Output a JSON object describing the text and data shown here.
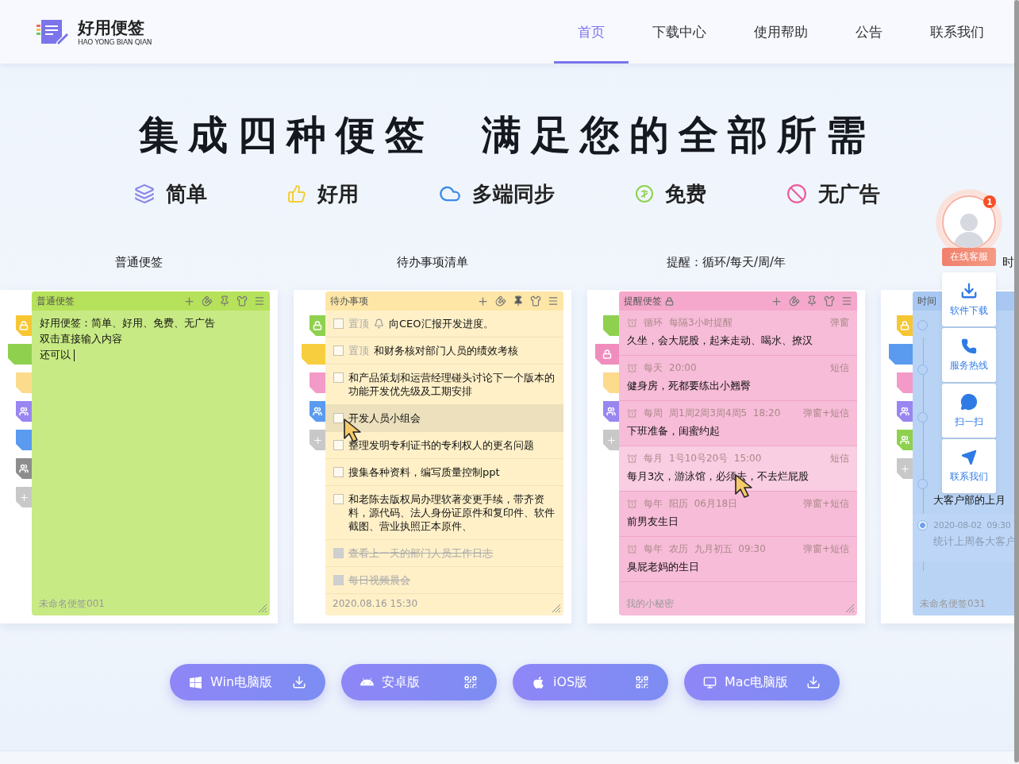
{
  "header": {
    "logo_title": "好用便签",
    "logo_subtitle": "HAO YONG BIAN QIAN",
    "nav": [
      {
        "label": "首页",
        "selected": true
      },
      {
        "label": "下载中心",
        "selected": false
      },
      {
        "label": "使用帮助",
        "selected": false
      },
      {
        "label": "公告",
        "selected": false
      },
      {
        "label": "联系我们",
        "selected": false
      }
    ]
  },
  "hero": {
    "headline": [
      "集成四种便签",
      "满足您的全部所需"
    ],
    "features": [
      {
        "label": "简单"
      },
      {
        "label": "好用"
      },
      {
        "label": "多端同步"
      },
      {
        "label": "免费"
      },
      {
        "label": "无广告"
      }
    ]
  },
  "showcase": [
    {
      "kind": "plain",
      "caption": "普通便签",
      "title": "普通便签",
      "footer": "未命名便签001",
      "editing": true,
      "tabs": [
        {
          "color": "#f7c634",
          "kind": "lock",
          "selected": false
        },
        {
          "color": "#8fd14f",
          "kind": "blank",
          "selected": true
        },
        {
          "color": "#fddb8c",
          "kind": "blank",
          "selected": false
        },
        {
          "color": "#9a86f0",
          "kind": "users",
          "selected": false
        },
        {
          "color": "#5a9bf0",
          "kind": "blank",
          "selected": false
        },
        {
          "color": "#8d8d8d",
          "kind": "users",
          "selected": false
        },
        {
          "color": "#c8c8c8",
          "kind": "plus",
          "selected": false
        }
      ],
      "lines": [
        "好用便签：简单、好用、免费、无广告",
        "双击直接输入内容",
        "还可以"
      ]
    },
    {
      "kind": "todo",
      "caption": "待办事项清单",
      "title": "待办事项",
      "footer": "2020.08.16  15:30",
      "tabs": [
        {
          "color": "#8fd14f",
          "kind": "lock",
          "selected": false
        },
        {
          "color": "#f7cf3e",
          "kind": "blank",
          "selected": true
        },
        {
          "color": "#f39ac8",
          "kind": "blank",
          "selected": false
        },
        {
          "color": "#5a9bf0",
          "kind": "users",
          "selected": false
        },
        {
          "color": "#c8c8c8",
          "kind": "plus",
          "selected": false
        }
      ],
      "items": [
        {
          "tag": "置顶",
          "bell": true,
          "text": "向CEO汇报开发进度。",
          "checked": false,
          "highlighted": false,
          "pointer": false
        },
        {
          "tag": "置顶",
          "bell": false,
          "text": "和财务核对部门人员的绩效考核",
          "checked": false,
          "highlighted": false,
          "pointer": false
        },
        {
          "text": "和产品策划和运营经理碰头讨论下一个版本的功能开发优先级及工期安排",
          "checked": false,
          "highlighted": false,
          "pointer": false
        },
        {
          "text": "开发人员小组会",
          "checked": false,
          "highlighted": true,
          "pointer": true
        },
        {
          "text": "整理发明专利证书的专利权人的更名问题",
          "checked": false,
          "highlighted": false,
          "pointer": false
        },
        {
          "text": "搜集各种资料，编写质量控制ppt",
          "checked": false,
          "highlighted": false,
          "pointer": false
        },
        {
          "text": "和老陈去版权局办理软著变更手续，带齐资料，源代码、法人身份证原件和复印件、软件截图、营业执照正本原件、",
          "checked": false,
          "highlighted": false,
          "pointer": false
        },
        {
          "text": "查看上一天的部门人员工作日志",
          "checked": true,
          "highlighted": false,
          "pointer": false
        },
        {
          "text": "每日视频晨会",
          "checked": true,
          "highlighted": false,
          "pointer": false
        }
      ]
    },
    {
      "kind": "reminder",
      "caption": "提醒：循环/每天/周/年",
      "title": "提醒便签",
      "locked": true,
      "footer": "我的小秘密",
      "tabs": [
        {
          "color": "#8fd14f",
          "kind": "blank",
          "selected": false
        },
        {
          "color": "#f08dbd",
          "kind": "lock",
          "selected": true
        },
        {
          "color": "#fddb8c",
          "kind": "blank",
          "selected": false
        },
        {
          "color": "#9a86f0",
          "kind": "users",
          "selected": false
        },
        {
          "color": "#c8c8c8",
          "kind": "plus",
          "selected": false
        }
      ],
      "items": [
        {
          "repeat": "循环",
          "schedule": "每隔3小时提醒",
          "channel": "弹窗",
          "text": "久坐，会大屁股，起来走动、喝水、撩汉",
          "highlighted": false,
          "pointer": false
        },
        {
          "repeat": "每天",
          "schedule": "20:00",
          "channel": "短信",
          "text": "健身房，死都要练出小翘臀",
          "highlighted": false,
          "pointer": false
        },
        {
          "repeat": "每周",
          "schedule": "周1周2周3周4周5  18:20",
          "channel": "弹窗+短信",
          "text": "下班准备，闺蜜约起",
          "highlighted": false,
          "pointer": false
        },
        {
          "repeat": "每月",
          "schedule": "1号10号20号  15:00",
          "channel": "短信",
          "text": "每月3次，游泳馆，必须去，不去烂屁股",
          "highlighted": true,
          "pointer": true
        },
        {
          "repeat": "每年",
          "schedule": "阳历  06月18日",
          "channel": "弹窗+短信",
          "text": "前男友生日",
          "highlighted": false,
          "pointer": false
        },
        {
          "repeat": "每年",
          "schedule": "农历  九月初五  09:30",
          "channel": "弹窗+短信",
          "text": "臭屁老妈的生日",
          "highlighted": false,
          "pointer": false
        }
      ]
    },
    {
      "kind": "timeline",
      "caption": "时",
      "title": "时间",
      "footer": "未命名便签031",
      "tabs": [
        {
          "color": "#f7c634",
          "kind": "lock",
          "selected": false
        },
        {
          "color": "#5a9bf0",
          "kind": "blank",
          "selected": true
        },
        {
          "color": "#f39ac8",
          "kind": "blank",
          "selected": false
        },
        {
          "color": "#9a86f0",
          "kind": "users",
          "selected": false
        },
        {
          "color": "#8fd14f",
          "kind": "users",
          "selected": false
        },
        {
          "color": "#c8c8c8",
          "kind": "plus",
          "selected": false
        }
      ],
      "items": [
        {
          "current": false
        },
        {
          "current": false
        },
        {
          "current": false
        },
        {
          "text": "大客户部的上月",
          "current": false
        },
        {
          "date": "2020-08-02  09:30",
          "text": "统计上周各大客户",
          "current": true
        }
      ]
    }
  ],
  "downloads": [
    {
      "kind": "download",
      "label": "Win电脑版"
    },
    {
      "kind": "qr",
      "label": "安卓版"
    },
    {
      "kind": "qr",
      "label": "iOS版"
    },
    {
      "kind": "download",
      "label": "Mac电脑版"
    }
  ],
  "float_panel": {
    "badge": "1",
    "service_label": "在线客服",
    "items": [
      {
        "label": "软件下载"
      },
      {
        "label": "服务热线"
      },
      {
        "label": "扫一扫"
      },
      {
        "label": "联系我们"
      }
    ]
  }
}
